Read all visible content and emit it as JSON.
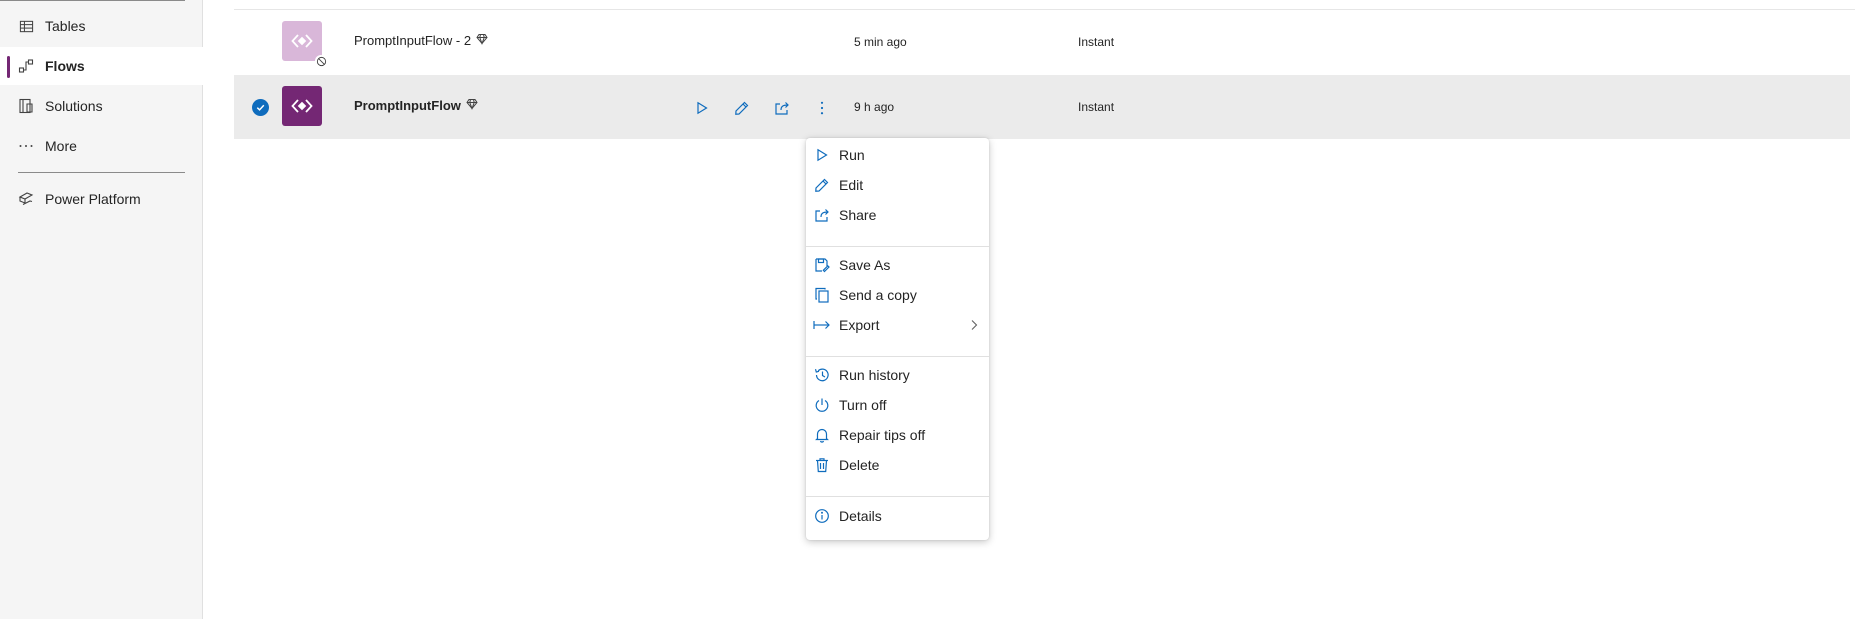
{
  "sidebar": {
    "items": [
      {
        "label": "Tables",
        "icon": "table-icon"
      },
      {
        "label": "Flows",
        "icon": "flow-icon",
        "selected": true
      },
      {
        "label": "Solutions",
        "icon": "solutions-icon"
      },
      {
        "label": "More",
        "icon": "more-icon"
      }
    ],
    "platform_label": "Power Platform"
  },
  "rows": [
    {
      "name": "PromptInputFlow - 2",
      "modified": "5 min ago",
      "type": "Instant",
      "status": "off"
    },
    {
      "name": "PromptInputFlow",
      "modified": "9 h ago",
      "type": "Instant",
      "status": "on"
    }
  ],
  "context_menu": {
    "items": [
      {
        "label": "Run",
        "icon": "play-icon"
      },
      {
        "label": "Edit",
        "icon": "pencil-icon"
      },
      {
        "label": "Share",
        "icon": "share-icon"
      },
      {
        "label": "Save As",
        "icon": "save-as-icon"
      },
      {
        "label": "Send a copy",
        "icon": "copy-icon"
      },
      {
        "label": "Export",
        "icon": "export-icon"
      },
      {
        "label": "Run history",
        "icon": "history-icon"
      },
      {
        "label": "Turn off",
        "icon": "power-icon"
      },
      {
        "label": "Repair tips off",
        "icon": "bell-icon"
      },
      {
        "label": "Delete",
        "icon": "trash-icon"
      },
      {
        "label": "Details",
        "icon": "info-icon"
      }
    ]
  },
  "colors": {
    "accent": "#742774",
    "accent_light": "#d9b7d9",
    "icon_blue": "#0f6cbd",
    "selected_row": "#ebebeb"
  }
}
